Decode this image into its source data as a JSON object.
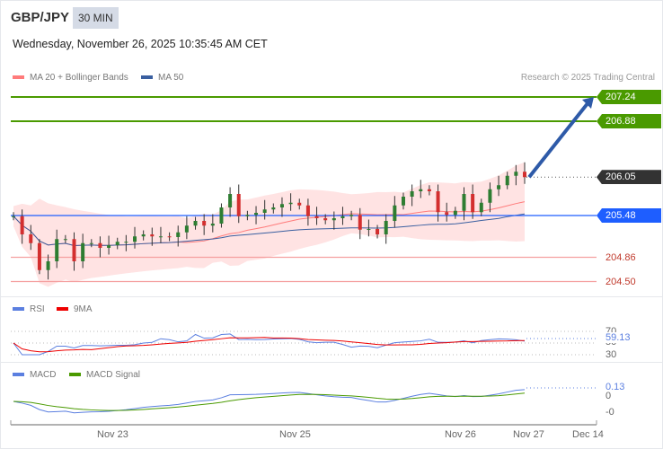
{
  "header": {
    "symbol": "GBP/JPY",
    "timeframe": "30 MIN",
    "datetime": "Wednesday, November 26, 2025 10:35:45 AM CET"
  },
  "legend": {
    "ma20": "MA 20 + Bollinger Bands",
    "ma50": "MA 50",
    "credit": "Research © 2025 Trading Central"
  },
  "rsi_legend": {
    "rsi": "RSI",
    "ma": "9MA"
  },
  "macd_legend": {
    "macd": "MACD",
    "signal": "MACD Signal"
  },
  "colors": {
    "green": "#4a9a00",
    "blue": "#1e5eff",
    "red": "#f28b8b",
    "dark": "#333333",
    "ma20": "#ff7b7b",
    "ma50": "#3a5fa0",
    "arrow": "#2e5aa8"
  },
  "chart_data": [
    {
      "type": "candlestick",
      "title": "GBP/JPY 30 MIN",
      "ylim": [
        204.3,
        207.5
      ],
      "first_open": 205.47,
      "closes": [
        205.47,
        205.2,
        205.07,
        204.67,
        204.8,
        205.13,
        205.13,
        204.8,
        205.07,
        205.07,
        205.0,
        205.04,
        205.09,
        205.09,
        205.17,
        205.2,
        205.17,
        205.17,
        205.16,
        205.23,
        205.33,
        205.4,
        205.33,
        205.36,
        205.6,
        205.8,
        205.47,
        205.49,
        205.52,
        205.57,
        205.6,
        205.65,
        205.67,
        205.63,
        205.47,
        205.44,
        205.41,
        205.44,
        205.47,
        205.49,
        205.27,
        205.28,
        205.2,
        205.4,
        205.63,
        205.76,
        205.84,
        205.87,
        205.84,
        205.53,
        205.49,
        205.55,
        205.8,
        205.53,
        205.67,
        205.87,
        205.93,
        206.07,
        206.13,
        206.05
      ],
      "levels": [
        {
          "label": "207.24",
          "value": 207.24,
          "type": "resistance"
        },
        {
          "label": "206.88",
          "value": 206.88,
          "type": "resistance"
        },
        {
          "label": "206.05",
          "value": 206.05,
          "type": "last"
        },
        {
          "label": "205.48",
          "value": 205.48,
          "type": "pivot"
        },
        {
          "label": "204.86",
          "value": 204.86,
          "type": "support"
        },
        {
          "label": "204.50",
          "value": 204.5,
          "type": "support"
        }
      ],
      "arrow_target": 207.24,
      "x_ticks": [
        "Nov 23",
        "Nov 25",
        "Nov 26",
        "Nov 27",
        "Dec 14"
      ]
    },
    {
      "type": "line",
      "title": "RSI",
      "current_label": "59.13",
      "ticks": [
        "70",
        "50",
        "30"
      ],
      "ylim": [
        0,
        100
      ]
    },
    {
      "type": "line",
      "title": "MACD",
      "current_label": "0.13",
      "ticks": [
        "0",
        "-0"
      ]
    }
  ]
}
